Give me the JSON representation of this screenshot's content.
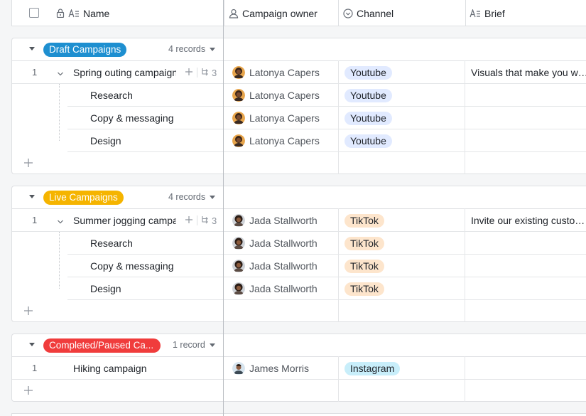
{
  "header": {
    "columns": [
      "Name",
      "Campaign owner",
      "Channel",
      "Brief"
    ]
  },
  "colors": {
    "draft": "#1e8fd0",
    "live": "#f5b400",
    "completed": "#f03c3c",
    "youtube": "#e1eaff",
    "tiktok": "#fde5cc",
    "instagram": "#c8eefa"
  },
  "groups": [
    {
      "label": "Draft Campaigns",
      "count": "4 records",
      "rows": [
        {
          "num": "1",
          "name": "Spring outing campaign",
          "sub_count": "3",
          "owner": "Latonya Capers",
          "channel": "Youtube",
          "brief": "Visuals that make you want to get outside"
        },
        {
          "name": "Research",
          "owner": "Latonya Capers",
          "channel": "Youtube",
          "brief": ""
        },
        {
          "name": "Copy & messaging",
          "owner": "Latonya Capers",
          "channel": "Youtube",
          "brief": ""
        },
        {
          "name": "Design",
          "owner": "Latonya Capers",
          "channel": "Youtube",
          "brief": ""
        }
      ]
    },
    {
      "label": "Live Campaigns",
      "count": "4 records",
      "rows": [
        {
          "num": "1",
          "name": "Summer jogging campaign",
          "sub_count": "3",
          "owner": "Jada Stallworth",
          "channel": "TikTok",
          "brief": "Invite our existing customers"
        },
        {
          "name": "Research",
          "owner": "Jada Stallworth",
          "channel": "TikTok",
          "brief": ""
        },
        {
          "name": "Copy & messaging",
          "owner": "Jada Stallworth",
          "channel": "TikTok",
          "brief": ""
        },
        {
          "name": "Design",
          "owner": "Jada Stallworth",
          "channel": "TikTok",
          "brief": ""
        }
      ]
    },
    {
      "label": "Completed/Paused Ca...",
      "count": "1 record",
      "rows": [
        {
          "num": "1",
          "name": "Hiking campaign",
          "owner": "James Morris",
          "channel": "Instagram",
          "brief": ""
        }
      ]
    }
  ]
}
